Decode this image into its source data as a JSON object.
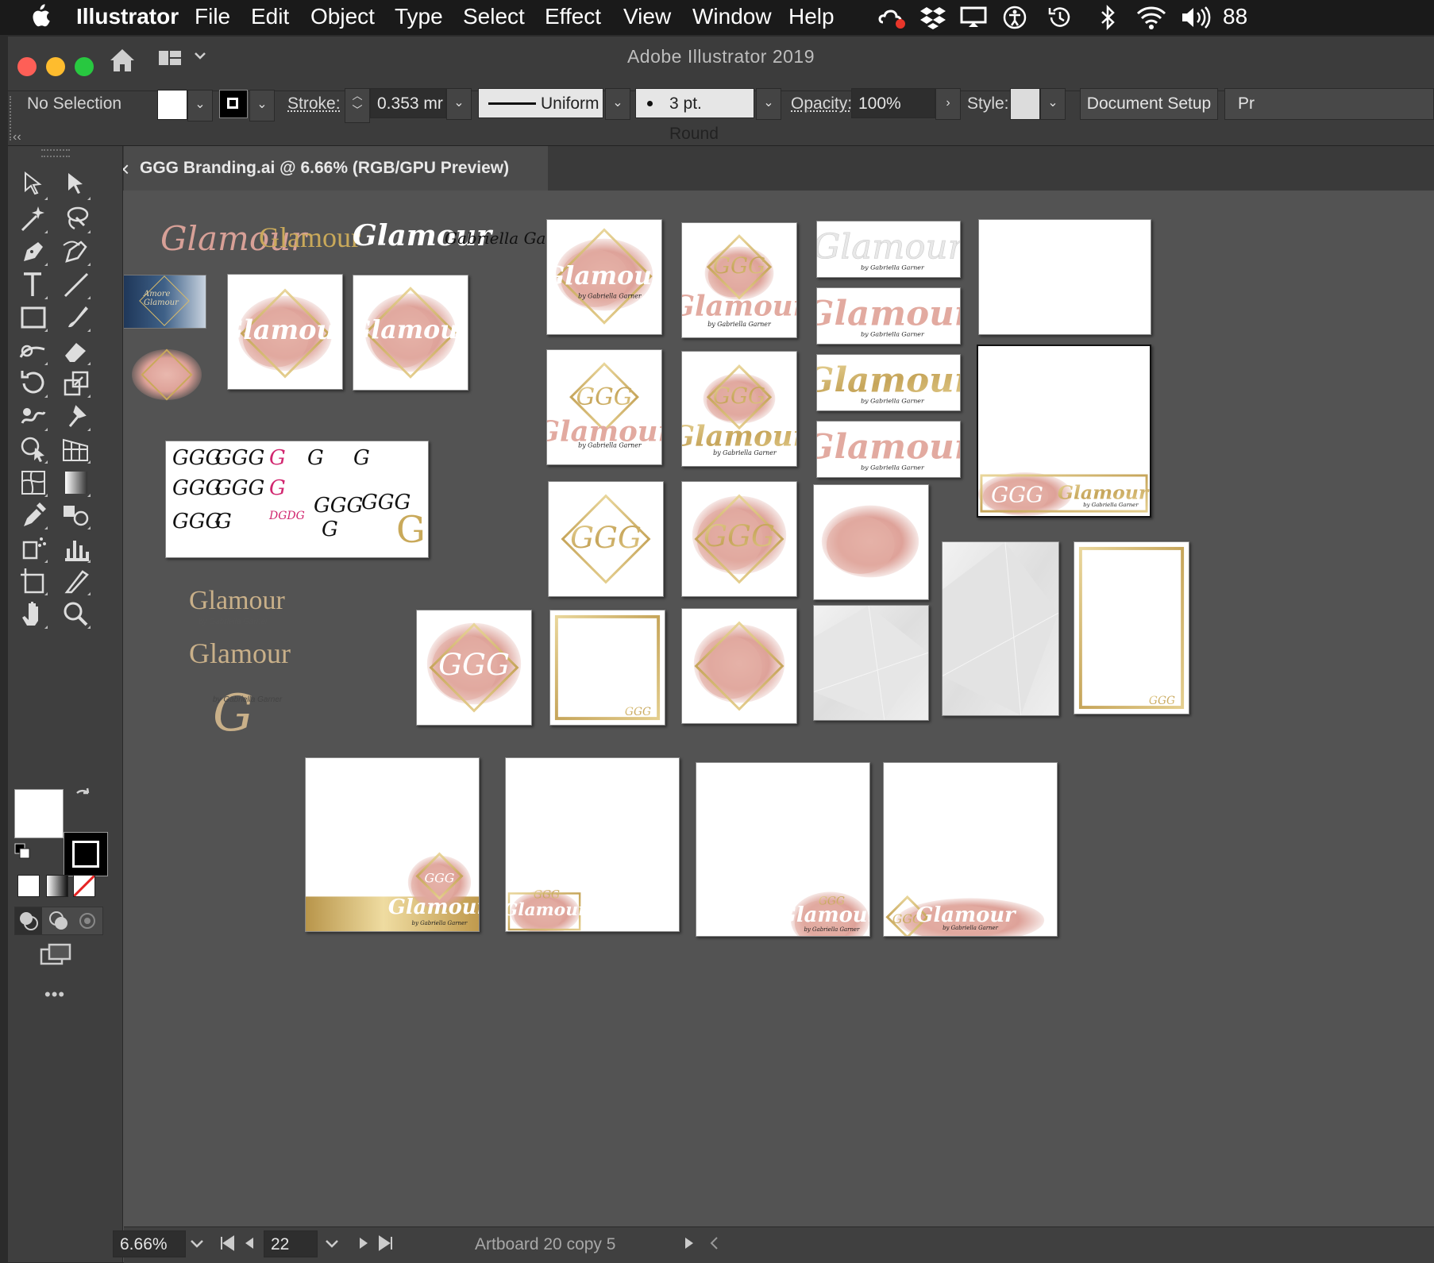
{
  "menubar": {
    "apple": "",
    "app_name": "Illustrator",
    "items": [
      "File",
      "Edit",
      "Object",
      "Type",
      "Select",
      "Effect",
      "View",
      "Window",
      "Help"
    ],
    "battery_text": "88"
  },
  "window": {
    "title": "Adobe Illustrator 2019",
    "traffic_lights": {
      "close": "#fe5f57",
      "minimize": "#febc2e",
      "zoom": "#28c840"
    }
  },
  "controlbar": {
    "selection_label": "No Selection",
    "stroke_label": "Stroke:",
    "stroke_value": "0.353 mr",
    "profile_label": "Uniform",
    "brush_label": "3 pt. Round",
    "opacity_label": "Opacity:",
    "opacity_value": "100%",
    "style_label": "Style:",
    "doc_setup_label": "Document Setup",
    "prefs_label": "Pr"
  },
  "document_tab": {
    "close_glyph": "×",
    "title": "GGG Branding.ai @ 6.66% (RGB/GPU Preview)"
  },
  "toolbar": {
    "collapse_glyph": "‹‹",
    "more_glyph": "•••",
    "tools": [
      "selection-tool",
      "direct-selection-tool",
      "magic-wand-tool",
      "lasso-tool",
      "pen-tool",
      "curvature-tool",
      "type-tool",
      "line-segment-tool",
      "rectangle-tool",
      "paintbrush-tool",
      "shaper-tool",
      "eraser-tool",
      "rotate-tool",
      "scale-tool",
      "warp-tool",
      "puppet-warp-tool",
      "shape-builder-tool",
      "perspective-grid-tool",
      "mesh-tool",
      "gradient-tool",
      "eyedropper-tool",
      "blend-tool",
      "symbol-sprayer-tool",
      "column-graph-tool",
      "artboard-tool",
      "slice-tool",
      "hand-tool",
      "zoom-tool"
    ]
  },
  "canvas": {
    "wordmark_text": "Glamour",
    "wordmark_small": "Gabriella Garner",
    "byline": "by Gabriella Garner",
    "monogram": "GGG",
    "mini_card_title": "Amore Glamour",
    "logo_sheet_items": [
      "GGG",
      "GGG",
      "G",
      "G",
      "GGG",
      "GGG",
      "G",
      "GGG",
      "G",
      "GGG",
      "GGG",
      "G",
      "DGDG",
      "G"
    ],
    "colors": {
      "rose": "#e2aaa0",
      "rose_dark": "#cf8f86",
      "gold": "#c9a95a",
      "gold_light": "#e3cd8b",
      "navy": "#2e4a6e"
    }
  },
  "statusbar": {
    "zoom_value": "6.66%",
    "artboard_number": "22",
    "artboard_name": "Artboard 20 copy 5"
  }
}
